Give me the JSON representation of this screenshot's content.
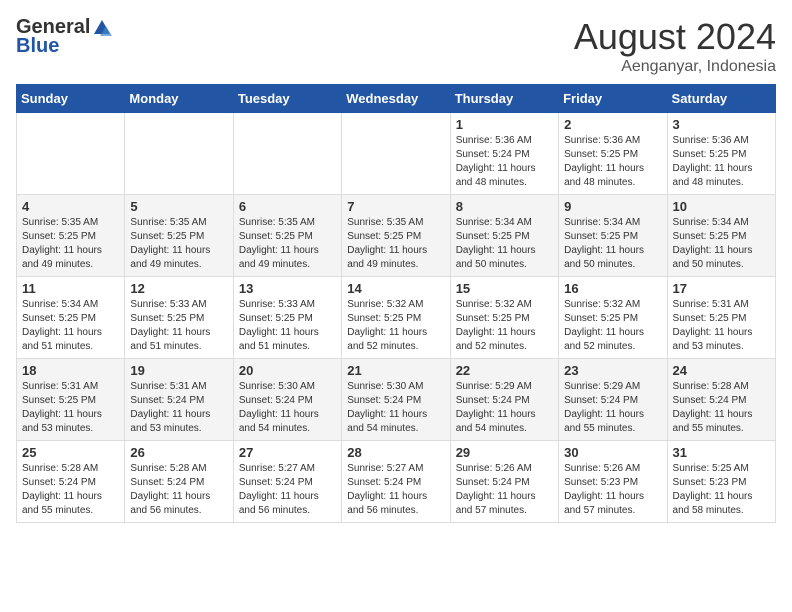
{
  "header": {
    "logo_general": "General",
    "logo_blue": "Blue",
    "month_year": "August 2024",
    "location": "Aenganyar, Indonesia"
  },
  "days_of_week": [
    "Sunday",
    "Monday",
    "Tuesday",
    "Wednesday",
    "Thursday",
    "Friday",
    "Saturday"
  ],
  "weeks": [
    [
      {
        "day": "",
        "info": ""
      },
      {
        "day": "",
        "info": ""
      },
      {
        "day": "",
        "info": ""
      },
      {
        "day": "",
        "info": ""
      },
      {
        "day": "1",
        "info": "Sunrise: 5:36 AM\nSunset: 5:24 PM\nDaylight: 11 hours\nand 48 minutes."
      },
      {
        "day": "2",
        "info": "Sunrise: 5:36 AM\nSunset: 5:25 PM\nDaylight: 11 hours\nand 48 minutes."
      },
      {
        "day": "3",
        "info": "Sunrise: 5:36 AM\nSunset: 5:25 PM\nDaylight: 11 hours\nand 48 minutes."
      }
    ],
    [
      {
        "day": "4",
        "info": "Sunrise: 5:35 AM\nSunset: 5:25 PM\nDaylight: 11 hours\nand 49 minutes."
      },
      {
        "day": "5",
        "info": "Sunrise: 5:35 AM\nSunset: 5:25 PM\nDaylight: 11 hours\nand 49 minutes."
      },
      {
        "day": "6",
        "info": "Sunrise: 5:35 AM\nSunset: 5:25 PM\nDaylight: 11 hours\nand 49 minutes."
      },
      {
        "day": "7",
        "info": "Sunrise: 5:35 AM\nSunset: 5:25 PM\nDaylight: 11 hours\nand 49 minutes."
      },
      {
        "day": "8",
        "info": "Sunrise: 5:34 AM\nSunset: 5:25 PM\nDaylight: 11 hours\nand 50 minutes."
      },
      {
        "day": "9",
        "info": "Sunrise: 5:34 AM\nSunset: 5:25 PM\nDaylight: 11 hours\nand 50 minutes."
      },
      {
        "day": "10",
        "info": "Sunrise: 5:34 AM\nSunset: 5:25 PM\nDaylight: 11 hours\nand 50 minutes."
      }
    ],
    [
      {
        "day": "11",
        "info": "Sunrise: 5:34 AM\nSunset: 5:25 PM\nDaylight: 11 hours\nand 51 minutes."
      },
      {
        "day": "12",
        "info": "Sunrise: 5:33 AM\nSunset: 5:25 PM\nDaylight: 11 hours\nand 51 minutes."
      },
      {
        "day": "13",
        "info": "Sunrise: 5:33 AM\nSunset: 5:25 PM\nDaylight: 11 hours\nand 51 minutes."
      },
      {
        "day": "14",
        "info": "Sunrise: 5:32 AM\nSunset: 5:25 PM\nDaylight: 11 hours\nand 52 minutes."
      },
      {
        "day": "15",
        "info": "Sunrise: 5:32 AM\nSunset: 5:25 PM\nDaylight: 11 hours\nand 52 minutes."
      },
      {
        "day": "16",
        "info": "Sunrise: 5:32 AM\nSunset: 5:25 PM\nDaylight: 11 hours\nand 52 minutes."
      },
      {
        "day": "17",
        "info": "Sunrise: 5:31 AM\nSunset: 5:25 PM\nDaylight: 11 hours\nand 53 minutes."
      }
    ],
    [
      {
        "day": "18",
        "info": "Sunrise: 5:31 AM\nSunset: 5:25 PM\nDaylight: 11 hours\nand 53 minutes."
      },
      {
        "day": "19",
        "info": "Sunrise: 5:31 AM\nSunset: 5:24 PM\nDaylight: 11 hours\nand 53 minutes."
      },
      {
        "day": "20",
        "info": "Sunrise: 5:30 AM\nSunset: 5:24 PM\nDaylight: 11 hours\nand 54 minutes."
      },
      {
        "day": "21",
        "info": "Sunrise: 5:30 AM\nSunset: 5:24 PM\nDaylight: 11 hours\nand 54 minutes."
      },
      {
        "day": "22",
        "info": "Sunrise: 5:29 AM\nSunset: 5:24 PM\nDaylight: 11 hours\nand 54 minutes."
      },
      {
        "day": "23",
        "info": "Sunrise: 5:29 AM\nSunset: 5:24 PM\nDaylight: 11 hours\nand 55 minutes."
      },
      {
        "day": "24",
        "info": "Sunrise: 5:28 AM\nSunset: 5:24 PM\nDaylight: 11 hours\nand 55 minutes."
      }
    ],
    [
      {
        "day": "25",
        "info": "Sunrise: 5:28 AM\nSunset: 5:24 PM\nDaylight: 11 hours\nand 55 minutes."
      },
      {
        "day": "26",
        "info": "Sunrise: 5:28 AM\nSunset: 5:24 PM\nDaylight: 11 hours\nand 56 minutes."
      },
      {
        "day": "27",
        "info": "Sunrise: 5:27 AM\nSunset: 5:24 PM\nDaylight: 11 hours\nand 56 minutes."
      },
      {
        "day": "28",
        "info": "Sunrise: 5:27 AM\nSunset: 5:24 PM\nDaylight: 11 hours\nand 56 minutes."
      },
      {
        "day": "29",
        "info": "Sunrise: 5:26 AM\nSunset: 5:24 PM\nDaylight: 11 hours\nand 57 minutes."
      },
      {
        "day": "30",
        "info": "Sunrise: 5:26 AM\nSunset: 5:23 PM\nDaylight: 11 hours\nand 57 minutes."
      },
      {
        "day": "31",
        "info": "Sunrise: 5:25 AM\nSunset: 5:23 PM\nDaylight: 11 hours\nand 58 minutes."
      }
    ]
  ]
}
